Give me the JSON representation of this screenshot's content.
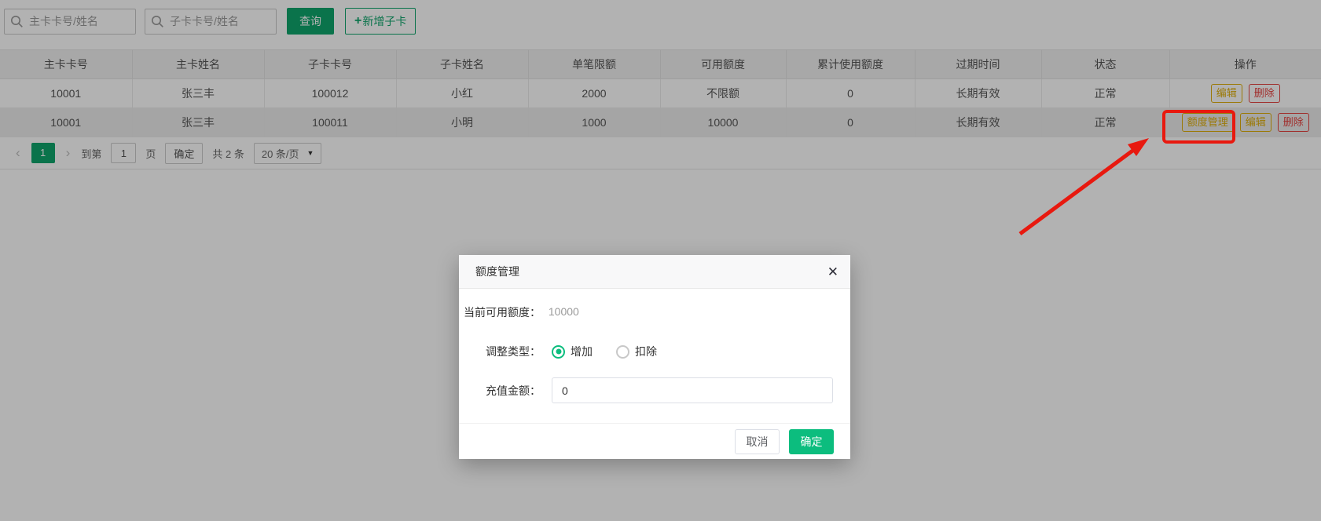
{
  "colors": {
    "green": "#0fa56c",
    "bright_green": "#0cbd7e",
    "yellow": "#dfae0a",
    "red": "#e64340",
    "annotation_red": "#e8190f"
  },
  "toolbar": {
    "search1_placeholder": "主卡卡号/姓名",
    "search2_placeholder": "子卡卡号/姓名",
    "query_label": "查询",
    "add_plus": "+",
    "add_label": "新增子卡"
  },
  "table": {
    "headers": [
      "主卡卡号",
      "主卡姓名",
      "子卡卡号",
      "子卡姓名",
      "单笔限额",
      "可用额度",
      "累计使用额度",
      "过期时间",
      "状态",
      "操作"
    ],
    "rows": [
      {
        "cells": [
          "10001",
          "张三丰",
          "100012",
          "小红",
          "2000",
          "不限额",
          "0",
          "长期有效",
          "正常"
        ],
        "actions": [
          "编辑",
          "删除"
        ]
      },
      {
        "cells": [
          "10001",
          "张三丰",
          "100011",
          "小明",
          "1000",
          "10000",
          "0",
          "长期有效",
          "正常"
        ],
        "actions": [
          "额度管理",
          "编辑",
          "删除"
        ]
      }
    ]
  },
  "pagination": {
    "prev": "‹",
    "page": "1",
    "next": "›",
    "goto_prefix": "到第",
    "goto_value": "1",
    "goto_suffix": "页",
    "confirm_label": "确定",
    "total_label": "共 2 条",
    "page_size": "20 条/页",
    "caret": "▼"
  },
  "modal": {
    "title": "额度管理",
    "close_icon": "✕",
    "current_label": "当前可用额度：",
    "current_value": "10000",
    "adjust_label": "调整类型：",
    "radio_increase": "增加",
    "radio_deduct": "扣除",
    "amount_label": "充值金额：",
    "amount_value": "0",
    "cancel_label": "取消",
    "ok_label": "确定"
  }
}
